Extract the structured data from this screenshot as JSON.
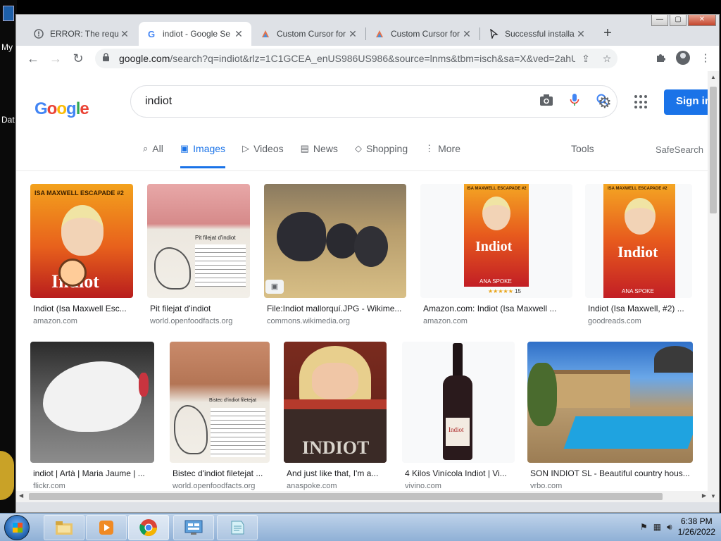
{
  "desktop": {
    "labels": [
      "My",
      "Dat"
    ]
  },
  "tabs": [
    {
      "title": "ERROR: The reque",
      "favicon": "warning-favicon-icon"
    },
    {
      "title": "indiot - Google Se",
      "favicon": "google-favicon-icon",
      "active": true
    },
    {
      "title": "Custom Cursor for",
      "favicon": "cursor-favicon-icon"
    },
    {
      "title": "Custom Cursor for",
      "favicon": "cursor-favicon-icon"
    },
    {
      "title": "Successful installa",
      "favicon": "pointer-favicon-icon"
    }
  ],
  "toolbar": {
    "url_domain": "google.com",
    "url_rest": "/search?q=indiot&rlz=1C1GCEA_enUS986US986&source=lnms&tbm=isch&sa=X&ved=2ahUKE..."
  },
  "search": {
    "query": "indiot",
    "logo_text": "Google",
    "sign_in": "Sign in"
  },
  "nav": {
    "tabs": [
      {
        "label": "All",
        "icon": "search-icon"
      },
      {
        "label": "Images",
        "icon": "image-icon",
        "active": true
      },
      {
        "label": "Videos",
        "icon": "video-icon"
      },
      {
        "label": "News",
        "icon": "news-icon"
      },
      {
        "label": "Shopping",
        "icon": "tag-icon"
      },
      {
        "label": "More",
        "icon": "more-vert-icon"
      }
    ],
    "tools": "Tools",
    "safesearch": "SafeSearch"
  },
  "results": [
    {
      "title": "Indiot (Isa Maxwell Esc...",
      "source": "amazon.com",
      "book_title": "Indiot",
      "book_series": "ISA MAXWELL ESCAPADE #2"
    },
    {
      "title": "Pit filejat d'indiot",
      "source": "world.openfoodfacts.org",
      "label_text": "Pit filejat d'indiot"
    },
    {
      "title": "File:Indiot mallorquí.JPG - Wikime...",
      "source": "commons.wikimedia.org"
    },
    {
      "title": "Amazon.com: Indiot (Isa Maxwell ...",
      "source": "amazon.com",
      "book_title": "Indiot",
      "book_series": "ISA MAXWELL ESCAPADE #2",
      "author": "ANA SPOKE",
      "rating_count": "15"
    },
    {
      "title": "Indiot (Isa Maxwell, #2) ...",
      "source": "goodreads.com",
      "book_title": "Indiot",
      "book_series": "ISA MAXWELL ESCAPADE #2",
      "author": "ANA SPOKE"
    },
    {
      "title": "indiot | Artà | Maria Jaume | ...",
      "source": "flickr.com"
    },
    {
      "title": "Bistec d'indiot filetejat ...",
      "source": "world.openfoodfacts.org",
      "label_text": "Bistec d'indiot filetejat"
    },
    {
      "title": "And just like that, I'm a...",
      "source": "anaspoke.com",
      "book_title": "INDIOT"
    },
    {
      "title": "4 Kilos Vinícola Indiot | Vi...",
      "source": "vivino.com",
      "label_text": "Indiot"
    },
    {
      "title": "SON INDIOT SL - Beautiful country hous...",
      "source": "vrbo.com"
    }
  ],
  "taskbar": {
    "time": "6:38 PM",
    "date": "1/26/2022"
  }
}
